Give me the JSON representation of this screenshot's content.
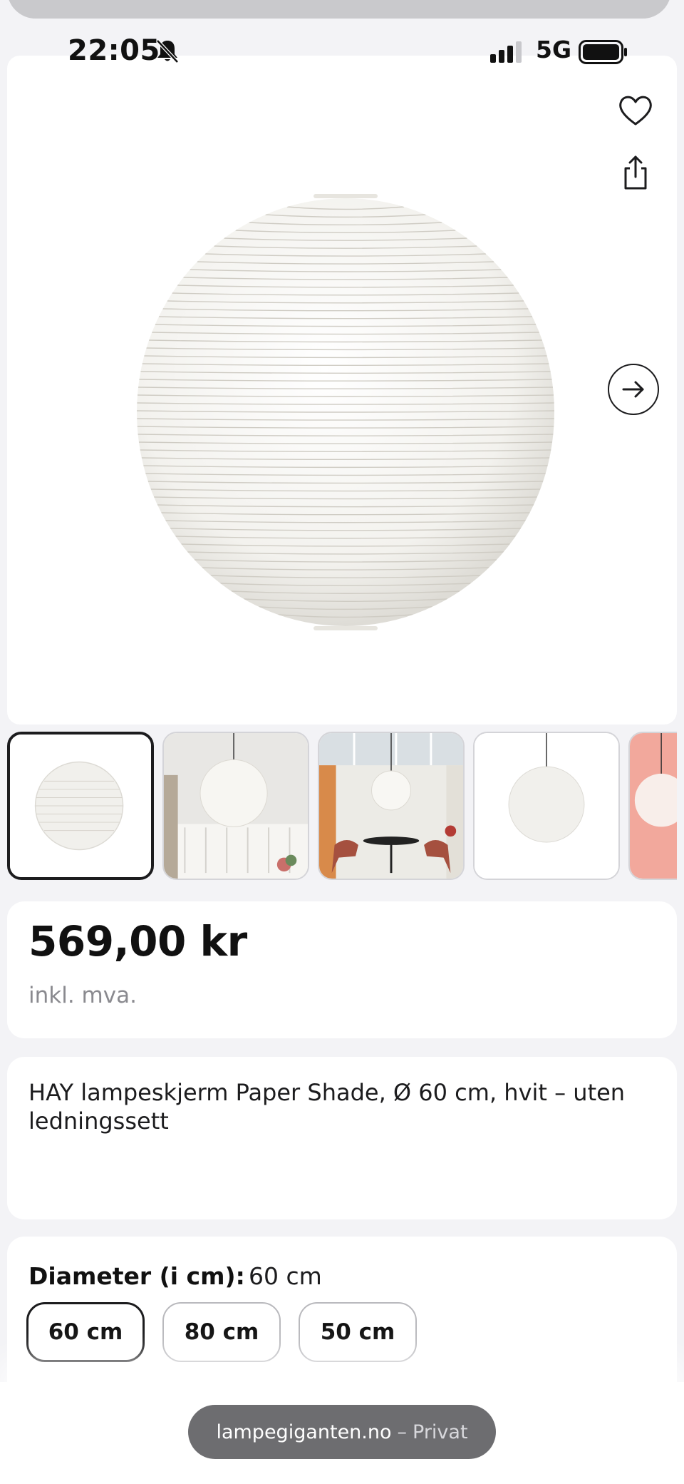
{
  "status_bar": {
    "time": "22:05",
    "network": "5G",
    "icons": [
      "bell-slash-icon",
      "cellular-signal-icon",
      "battery-icon"
    ]
  },
  "gallery": {
    "icons": [
      "heart-icon",
      "share-icon",
      "arrow-right-icon"
    ],
    "thumbnails": [
      {
        "name": "thumbnail-shade-white",
        "selected": true
      },
      {
        "name": "thumbnail-room-wainscot",
        "selected": false
      },
      {
        "name": "thumbnail-dining-room",
        "selected": false
      },
      {
        "name": "thumbnail-pendant-white",
        "selected": false
      },
      {
        "name": "thumbnail-pink-background",
        "selected": false
      }
    ]
  },
  "product": {
    "price": "569,00 kr",
    "vat_note": "inkl. mva.",
    "title": "HAY lampeskjerm Paper Shade, Ø 60 cm, hvit – uten ledningssett"
  },
  "variant": {
    "label": "Diameter (i cm):",
    "selected_value": "60 cm",
    "options": [
      "60 cm",
      "80 cm",
      "50 cm"
    ]
  },
  "browser": {
    "domain": "lampegiganten.no",
    "separator": "–",
    "mode": "Privat"
  },
  "colors": {
    "background": "#f3f3f6",
    "card": "#ffffff",
    "text": "#1c1c1e",
    "muted": "#8a8a8f",
    "pill": "#6d6d70"
  }
}
